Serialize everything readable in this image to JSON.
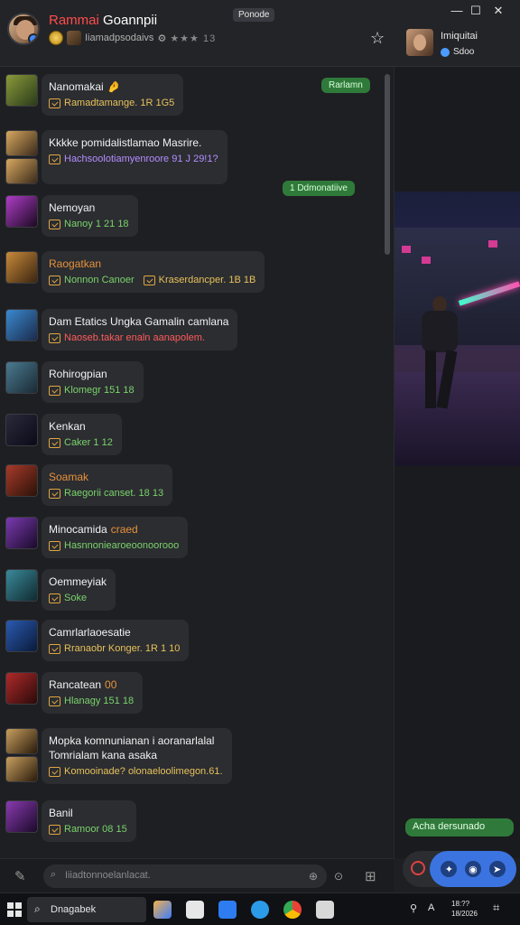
{
  "header": {
    "title_red": "Rammai",
    "title_white": "Goannpii",
    "subtitle": "Iiamadpsodaivs",
    "rating": "★★★ 13",
    "top_badge": "Ponode"
  },
  "window_controls": {
    "minimize": "—",
    "maximize": "☐",
    "close": "✕"
  },
  "side_user": {
    "name": "Imiquitai",
    "status": "Sdoo"
  },
  "chat": [
    {
      "name": "Nanomakai",
      "emoji": "🤌",
      "meta": "Ramadtamange. 1R 1G5",
      "meta_color": "#e8c15a",
      "thumb": [
        "#8a9a3a",
        "#2a3a1a"
      ]
    },
    {
      "name": "Kkkke pomidalistlamao Masrire.",
      "meta": "Hachsoolotiamyenroore 91 J 29!1?",
      "meta_color": "#b58cff",
      "thumb": [
        "#d8a860",
        "#3a2a1a"
      ],
      "double": true
    },
    {
      "name": "Nemoyan",
      "emoji": "",
      "meta": "Nanoy 1 21 18",
      "meta_color": "#7bd36a",
      "thumb": [
        "#b03cc8",
        "#1a0a20"
      ]
    },
    {
      "name": "Raogatkan",
      "meta": "Nonnon Canoer",
      "meta2": "Kraserdancper. 1B 1B",
      "meta_color": "#7bd36a",
      "meta2_color": "#e8c15a",
      "name_color": "#e8913a",
      "thumb": [
        "#c88a3a",
        "#3a2410"
      ]
    },
    {
      "name": "Dam Etatics Ungka Gamalin camlana",
      "meta": "Naoseb.takar enaln aanapolem.",
      "meta_color": "#ff5a5a",
      "thumb": [
        "#3a8ad0",
        "#1a2a4a"
      ]
    },
    {
      "name": "Rohirogpian",
      "meta": "Klomegr 151 18",
      "meta_color": "#7bd36a",
      "thumb": [
        "#4a7a90",
        "#1a2a34"
      ]
    },
    {
      "name": "Kenkan",
      "meta": "Caker 1 12",
      "meta_color": "#7bd36a",
      "thumb": [
        "#2a2a3a",
        "#0a0a18"
      ]
    },
    {
      "name": "Soamak",
      "meta": "Raegorii canset. 18 13",
      "meta_color": "#7bd36a",
      "name_color": "#e8913a",
      "thumb": [
        "#a83a2a",
        "#2a1208"
      ]
    },
    {
      "name": "Minocamida",
      "emoji": "",
      "name2": "craed",
      "meta": "Hasnnoniearoeoonoorooo",
      "meta_color": "#7bd36a",
      "thumb": [
        "#7a3ab0",
        "#1a0a2a"
      ]
    },
    {
      "name": "Oemmeyiak",
      "meta": "Soke",
      "meta_color": "#7bd36a",
      "thumb": [
        "#3a8a9a",
        "#102a30"
      ]
    },
    {
      "name": "Camrlarlaoesatie",
      "meta": "Rranaobr Konger. 1R 1 10",
      "meta_color": "#e8c15a",
      "thumb": [
        "#2a5ab0",
        "#0a1a3a"
      ]
    },
    {
      "name": "Rancatean",
      "name2": "00",
      "meta": "Hlanagy 151 18",
      "meta_color": "#7bd36a",
      "thumb": [
        "#b02a2a",
        "#2a0a0a"
      ]
    },
    {
      "name": "Mopka komnunianan i aoranarlalal",
      "name_line2": "Tomrialam kana asaka",
      "meta": "Komooinade? olonaeloolimegon.61.",
      "meta_color": "#e8c15a",
      "thumb": [
        "#c8a060",
        "#2a1a0a"
      ],
      "double": true
    },
    {
      "name": "Banil",
      "meta": "Ramoor 08 15",
      "meta_color": "#7bd36a",
      "thumb": [
        "#8a3ab0",
        "#1a0a2a"
      ]
    }
  ],
  "pills": {
    "top": "Rarlamn",
    "second": "1 Ddmonatiive",
    "action": "Acha dersunado"
  },
  "composer": {
    "placeholder": "Iiiadtonnoelanlacat."
  },
  "taskbar": {
    "search": "Dnagabek",
    "clock_time": "18:??",
    "clock_date": "18/2026"
  }
}
